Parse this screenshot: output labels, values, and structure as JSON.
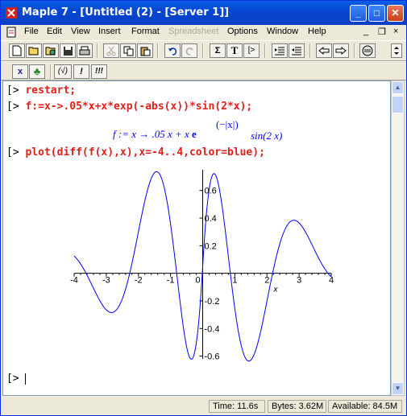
{
  "window": {
    "title": "Maple 7  - [Untitled (2) - [Server 1]]",
    "minimize": "_",
    "maximize": "□",
    "close": "✕"
  },
  "menu": {
    "items": [
      "File",
      "Edit",
      "View",
      "Insert",
      "Format",
      "Spreadsheet",
      "Options",
      "Window",
      "Help"
    ],
    "disabled": [
      "Spreadsheet"
    ],
    "mdi_minimize": "_",
    "mdi_restore": "❐",
    "mdi_close": "×"
  },
  "toolbar1": {
    "icons": [
      "new-icon",
      "open-icon",
      "open-url-icon",
      "save-icon",
      "print-icon",
      "cut-icon",
      "copy-icon",
      "paste-icon",
      "undo-icon",
      "redo-icon",
      "sigma-icon",
      "text-icon",
      "prompt-icon",
      "indent-icon",
      "outdent-icon",
      "back-icon",
      "forward-icon",
      "stop-icon"
    ],
    "sigma": "Σ",
    "text": "T",
    "prompt": "[>"
  },
  "toolbar2": {
    "interrupt": "x",
    "maple_leaf": "♣",
    "check": "(√)",
    "exec1": "!",
    "exec_all": "!!!"
  },
  "worksheet": {
    "prompt": "[>",
    "cmd1": "restart;",
    "cmd2": "f:=x->.05*x+x*exp(-abs(x))*sin(2*x);",
    "output2": {
      "lhs": "f := x → .05 x + x",
      "exp_e": "e",
      "exp_arg": "(−|x|)",
      "tail": "sin(2 x)"
    },
    "cmd3": "plot(diff(f(x),x),x=-4..4,color=blue);",
    "final_prompt": "[>"
  },
  "chart_data": {
    "type": "line",
    "title": "",
    "xlabel": "x",
    "ylabel": "",
    "xlim": [
      -4,
      4
    ],
    "ylim": [
      -0.62,
      0.75
    ],
    "xticks": [
      -4,
      -3,
      -2,
      -1,
      0,
      1,
      2,
      3,
      4
    ],
    "xtick_labels": [
      "-4",
      "-3",
      "-2",
      "-1",
      "0",
      "1",
      "2",
      "3",
      "4"
    ],
    "yticks": [
      -0.6,
      -0.4,
      -0.2,
      0.2,
      0.4,
      0.6
    ],
    "ytick_labels": [
      "-0.6",
      "-0.4",
      "-0.2",
      "0.2",
      "0.4",
      "0.6"
    ],
    "series": [
      {
        "color": "#0000ff",
        "expression": "d/dx (0.05x + x·exp(-|x|)·sin(2x))"
      }
    ],
    "grid": false
  },
  "status": {
    "time": "Time: 11.6s",
    "bytes": "Bytes: 3.62M",
    "available": "Available: 84.5M"
  }
}
